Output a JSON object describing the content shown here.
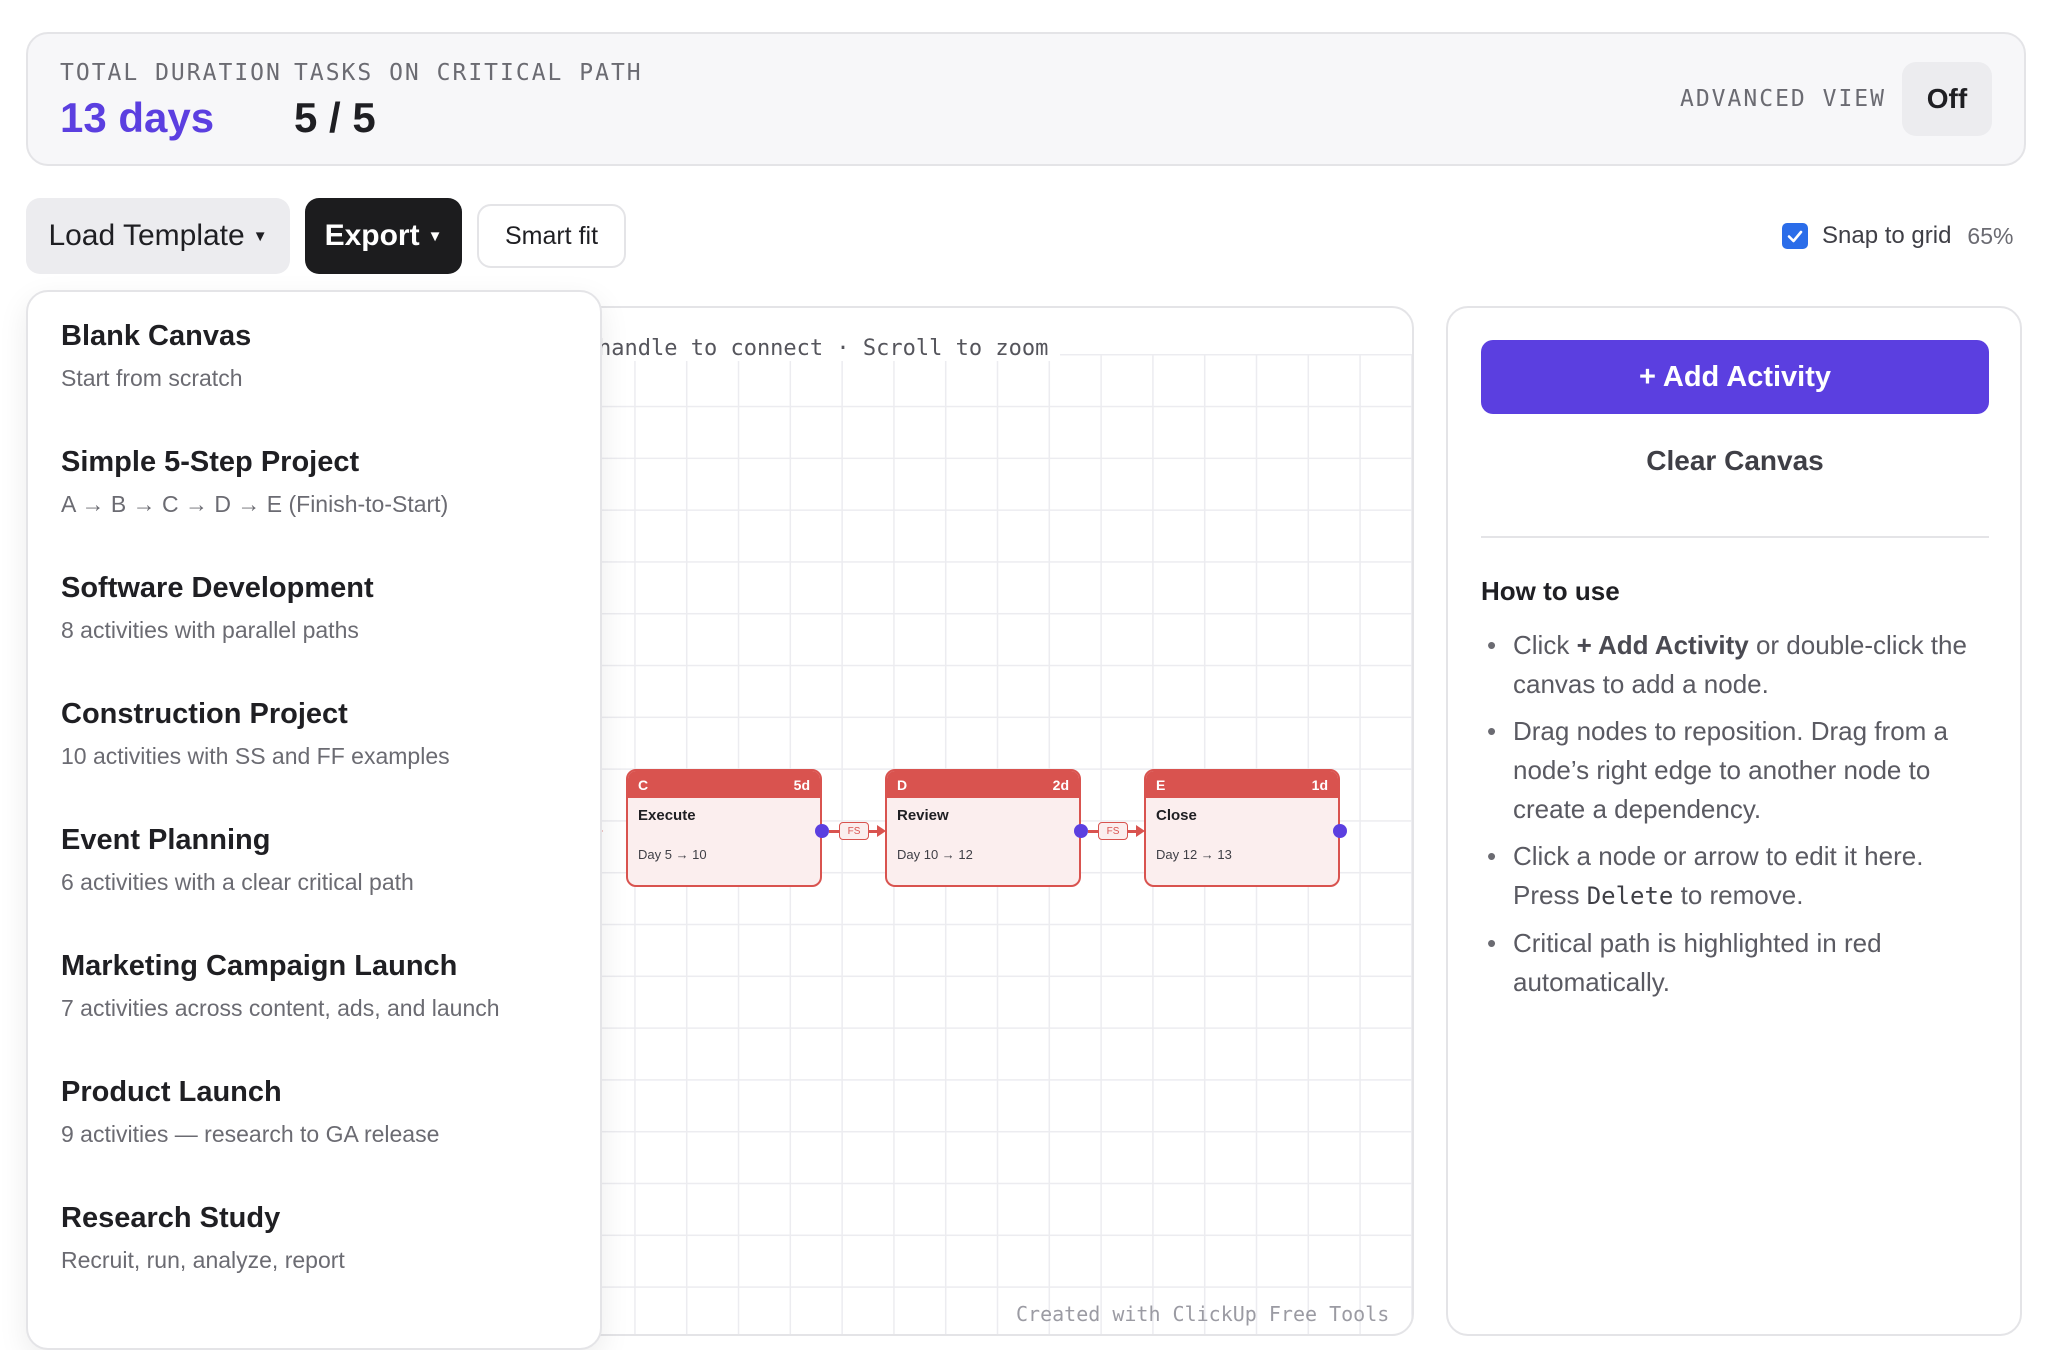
{
  "stats": {
    "duration_label": "TOTAL DURATION",
    "duration_value": "13 days",
    "critical_label": "TASKS ON CRITICAL PATH",
    "critical_value": "5 / 5",
    "advanced_label": "ADVANCED VIEW",
    "advanced_value": "Off"
  },
  "toolbar": {
    "template_label": "Load Template",
    "export_label": "Export",
    "smart_fit_label": "Smart fit",
    "snap_label": "Snap to grid",
    "snap_checked": true,
    "zoom": "65%"
  },
  "canvas": {
    "hint": "handle to connect · Scroll to zoom",
    "credit": "Created with ClickUp Free Tools",
    "critical_color": "#d9534f",
    "handle_color": "#5b3fe0",
    "nodes": [
      {
        "id": "C",
        "duration": "5d",
        "name": "Execute",
        "days": "Day 5 → 10"
      },
      {
        "id": "D",
        "duration": "2d",
        "name": "Review",
        "days": "Day 10 → 12"
      },
      {
        "id": "E",
        "duration": "1d",
        "name": "Close",
        "days": "Day 12 → 13"
      }
    ],
    "edges": [
      {
        "label": "FS"
      },
      {
        "label": "FS"
      }
    ]
  },
  "templates": [
    {
      "title": "Blank Canvas",
      "desc": "Start from scratch"
    },
    {
      "title": "Simple 5-Step Project",
      "desc": "A → B → C → D → E (Finish-to-Start)"
    },
    {
      "title": "Software Development",
      "desc": "8 activities with parallel paths"
    },
    {
      "title": "Construction Project",
      "desc": "10 activities with SS and FF examples"
    },
    {
      "title": "Event Planning",
      "desc": "6 activities with a clear critical path"
    },
    {
      "title": "Marketing Campaign Launch",
      "desc": "7 activities across content, ads, and launch"
    },
    {
      "title": "Product Launch",
      "desc": "9 activities — research to GA release"
    },
    {
      "title": "Research Study",
      "desc": "Recruit, run, analyze, report"
    }
  ],
  "panel": {
    "add_label": "+ Add Activity",
    "clear_label": "Clear Canvas",
    "howto_title": "How to use",
    "tip1_a": "Click ",
    "tip1_b": "+ Add Activity",
    "tip1_c": " or double-click the canvas to add a node.",
    "tip2": "Drag nodes to reposition. Drag from a node’s right edge to another node to create a dependency.",
    "tip3_a": "Click a node or arrow to edit it here. Press ",
    "tip3_b": "Delete",
    "tip3_c": " to remove.",
    "tip4": "Critical path is highlighted in red automatically.",
    "accent": "#5b3fe0"
  }
}
